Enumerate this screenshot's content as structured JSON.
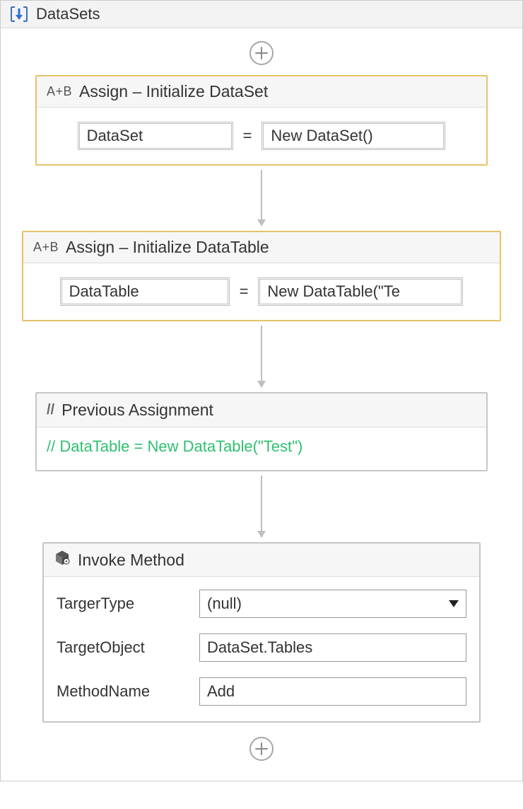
{
  "workflow": {
    "title": "DataSets"
  },
  "activities": {
    "assign1": {
      "header_prefix": "A+B",
      "title": "Assign – Initialize DataSet",
      "left": "DataSet",
      "eq": "=",
      "right": "New DataSet()"
    },
    "assign2": {
      "header_prefix": "A+B",
      "title": "Assign – Initialize DataTable",
      "left": "DataTable",
      "eq": "=",
      "right": "New DataTable(\"Te"
    },
    "comment": {
      "prefix": "//",
      "title": "Previous Assignment",
      "body": "// DataTable = New DataTable(\"Test\")"
    },
    "invoke": {
      "title": "Invoke Method",
      "rows": {
        "target_type": {
          "label": "TargerType",
          "value": "(null)"
        },
        "target_object": {
          "label": "TargetObject",
          "value": "DataSet.Tables"
        },
        "method_name": {
          "label": "MethodName",
          "value": "Add"
        }
      }
    }
  }
}
